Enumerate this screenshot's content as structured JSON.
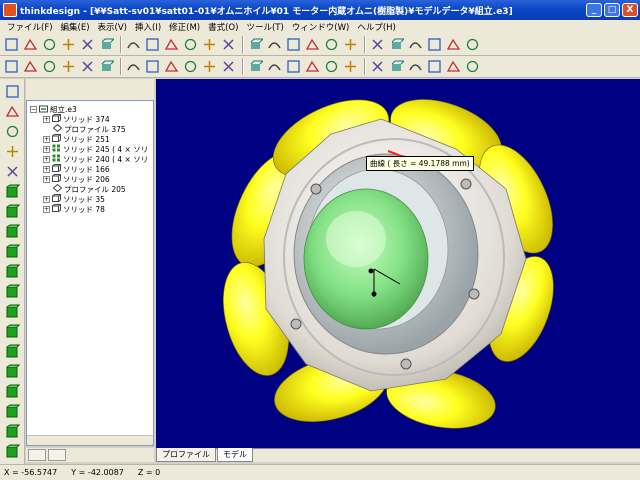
{
  "window": {
    "app_name": "thinkdesign",
    "title": "thinkdesign - [¥¥Satt-sv01¥satt01-01¥オムニホイル¥01 モーター内蔵オムニ(樹脂製)¥モデルデータ¥組立.e3]",
    "minimize": "_",
    "maximize": "□",
    "close": "X"
  },
  "menu": [
    {
      "label": "ファイル(F)"
    },
    {
      "label": "編集(E)"
    },
    {
      "label": "表示(V)"
    },
    {
      "label": "挿入(I)"
    },
    {
      "label": "修正(M)"
    },
    {
      "label": "書式(O)"
    },
    {
      "label": "ツール(T)"
    },
    {
      "label": "ウィンドウ(W)"
    },
    {
      "label": "ヘルプ(H)"
    }
  ],
  "toolbar1": [
    "new-icon",
    "open-icon",
    "save-icon",
    "undo-icon",
    "redo-icon",
    "cube-select-icon",
    "move-icon",
    "zoom-icon",
    "rotate-icon",
    "pan-icon",
    "grid-icon",
    "zoom-window-icon",
    "arrow-select-icon",
    "arrow-filter-icon",
    "tool-icon",
    "tool2-icon",
    "delete-icon",
    "trim-icon",
    "measure-icon",
    "extend-icon",
    "fillet-icon",
    "chamfer-icon",
    "shade-icon",
    "wire-icon"
  ],
  "toolbar2": [
    "curve-icon",
    "point-icon",
    "spline-icon",
    "ellipse-icon",
    "circle-icon",
    "hatch-icon",
    "extrude-icon",
    "revolve-icon",
    "sweep-icon",
    "loft-icon",
    "shell-icon",
    "boolean-icon",
    "thread-icon",
    "hole-icon",
    "cylinder-icon",
    "plane-icon",
    "surface-icon",
    "fill-icon",
    "offset-icon",
    "blend-icon",
    "knife-icon",
    "hand-icon",
    "chain-icon",
    "gear-icon"
  ],
  "tree": {
    "root": "組立.e3",
    "nodes": [
      {
        "label": "ソリッド 374",
        "expander": "+",
        "icon": "solid"
      },
      {
        "label": "プロファイル 375",
        "expander": "",
        "icon": "profile"
      },
      {
        "label": "ソリッド 251",
        "expander": "+",
        "icon": "solid"
      },
      {
        "label": "ソリッド 245 ( 4 × ソリ",
        "expander": "+",
        "icon": "pattern"
      },
      {
        "label": "ソリッド 240 ( 4 × ソリ",
        "expander": "+",
        "icon": "pattern"
      },
      {
        "label": "ソリッド 166",
        "expander": "+",
        "icon": "solid"
      },
      {
        "label": "ソリッド 206",
        "expander": "+",
        "icon": "solid"
      },
      {
        "label": "プロファイル 205",
        "expander": "",
        "icon": "profile"
      },
      {
        "label": "ソリッド 35",
        "expander": "+",
        "icon": "solid"
      },
      {
        "label": "ソリッド 78",
        "expander": "+",
        "icon": "solid"
      }
    ]
  },
  "viewport": {
    "tooltip": "曲線 ( 長さ = 49.1788 mm)",
    "background_color": "#000082",
    "roller_color": "#ffff00",
    "hub_color": "#e8e4dc",
    "core_color": "#7ce07c"
  },
  "tabs": [
    {
      "label": "プロファイル"
    },
    {
      "label": "モデル"
    }
  ],
  "status": {
    "x": "X = -56.5747",
    "y": "Y = -42.0087",
    "z": "Z = 0"
  }
}
